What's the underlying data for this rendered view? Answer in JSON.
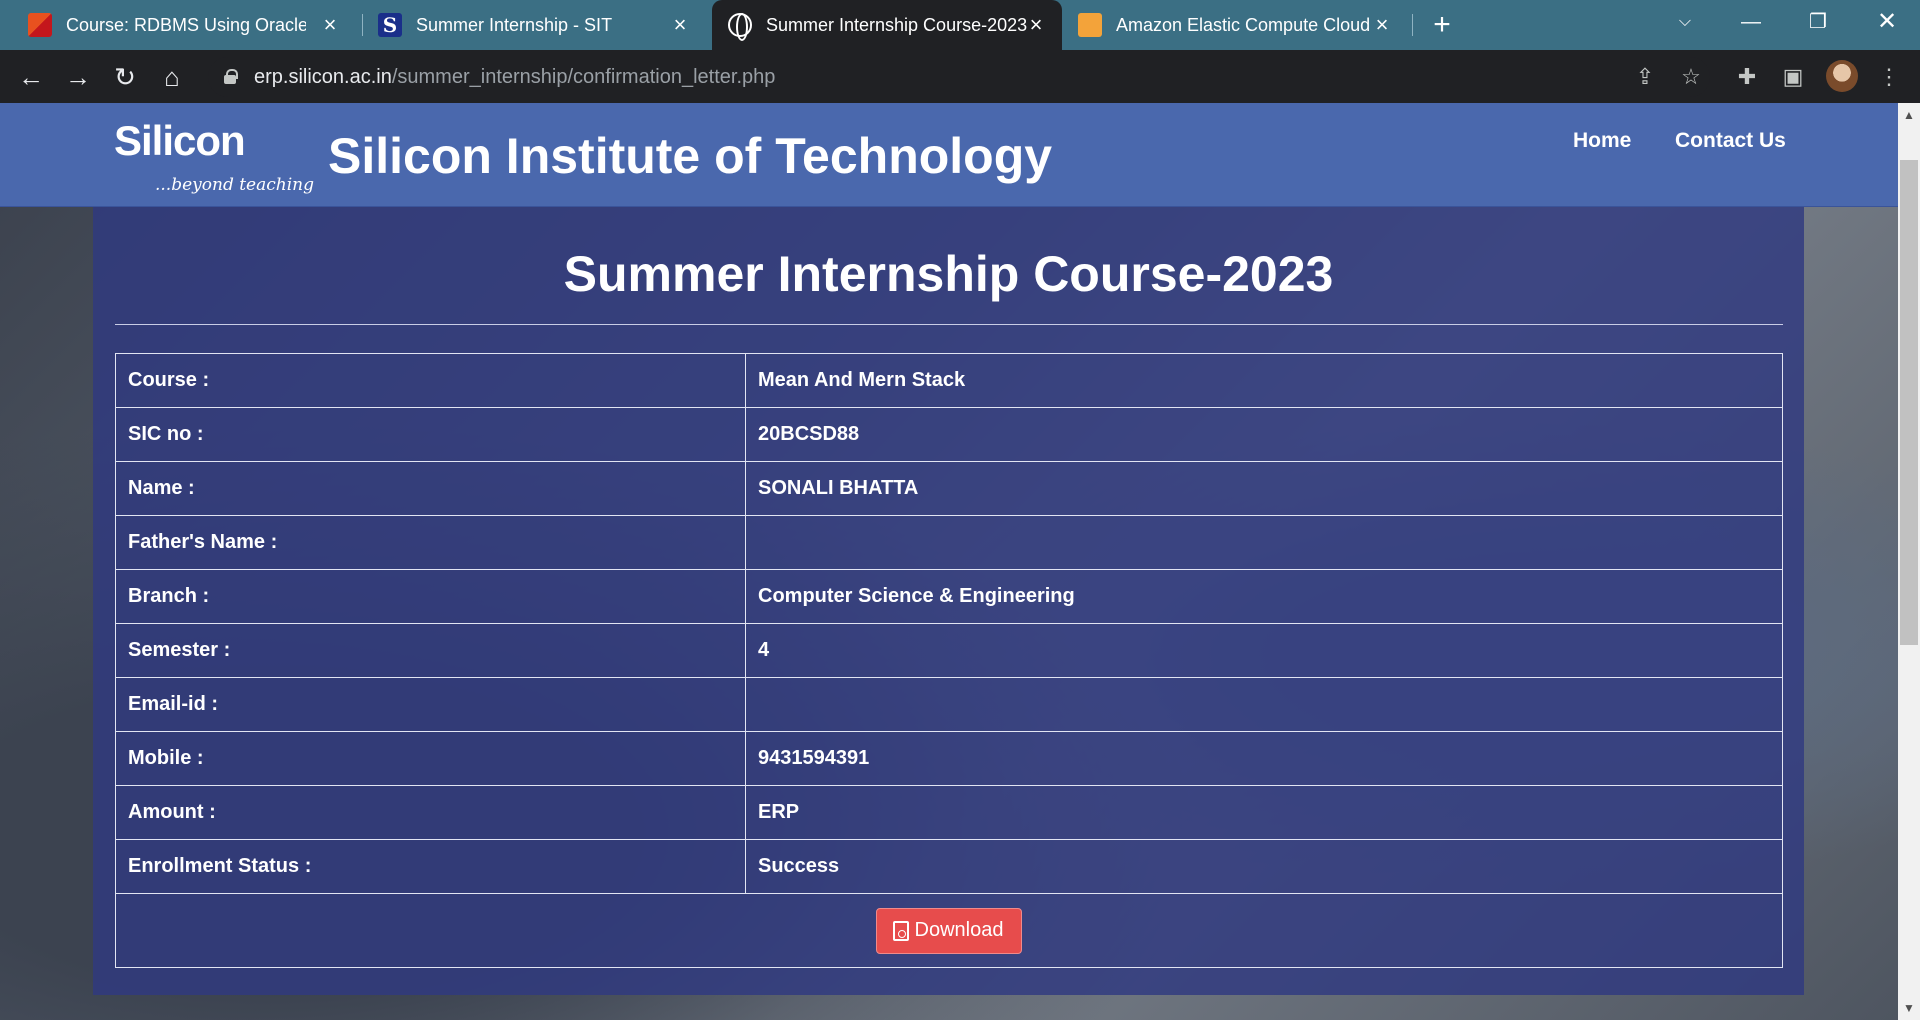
{
  "browser": {
    "tabs": [
      {
        "title": "Course: RDBMS Using Oracle",
        "icon": "oracle-favicon-icon"
      },
      {
        "title": "Summer Internship - SIT",
        "icon": "silicon-s-favicon-icon",
        "favicon_letter": "S"
      },
      {
        "title": "Summer Internship Course-2023",
        "icon": "globe-favicon-icon",
        "active": true
      },
      {
        "title": "Amazon Elastic Compute Cloud (",
        "icon": "aws-box-favicon-icon"
      }
    ],
    "url_host": "erp.silicon.ac.in",
    "url_path": "/summer_internship/confirmation_letter.php"
  },
  "site": {
    "logo_word": "Silicon",
    "logo_tagline": "...beyond teaching",
    "name": "Silicon Institute of Technology",
    "nav": [
      "Home",
      "Contact Us"
    ],
    "header_color": "#4a68ad"
  },
  "panel": {
    "title": "Summer Internship Course-2023",
    "rows": [
      {
        "label": "Course :",
        "value": "Mean And Mern Stack"
      },
      {
        "label": "SIC no :",
        "value": "20BCSD88"
      },
      {
        "label": "Name :",
        "value": "SONALI BHATTA"
      },
      {
        "label": "Father's Name :",
        "value": ""
      },
      {
        "label": "Branch :",
        "value": "Computer Science & Engineering"
      },
      {
        "label": "Semester :",
        "value": "4"
      },
      {
        "label": "Email-id :",
        "value": ""
      },
      {
        "label": "Mobile :",
        "value": "9431594391"
      },
      {
        "label": "Amount :",
        "value": "ERP"
      },
      {
        "label": "Enrollment Status :",
        "value": "Success"
      }
    ],
    "download_label": "Download",
    "download_color": "#e74c4c"
  }
}
